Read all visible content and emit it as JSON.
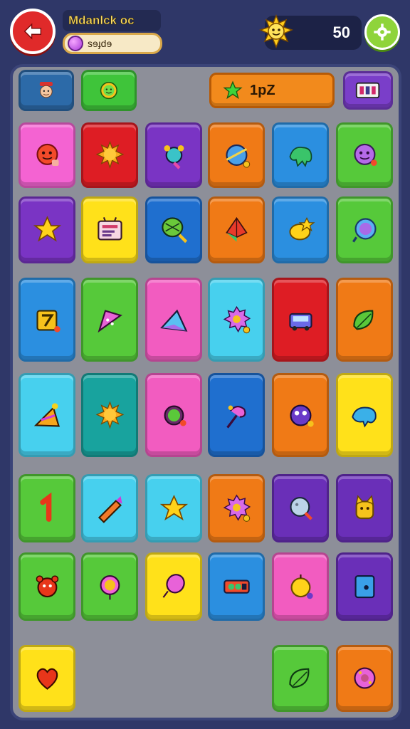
{
  "header": {
    "title": "Mdanlck oc",
    "progress_text": "sɘɟdɘ",
    "score": "50",
    "icons": {
      "back": "back-arrow-icon",
      "score": "sun-icon",
      "settings": "gear-icon",
      "gem": "gem-icon"
    }
  },
  "hud": {
    "level_text": "1pZ",
    "icons": [
      "avatar-icon",
      "smiley-icon",
      "star-icon",
      "menu-icon"
    ]
  },
  "board": {
    "colors": {
      "pink": "#f463d2",
      "red": "#de1d24",
      "purple": "#7a34c4",
      "orange": "#f07a16",
      "blue": "#2b8fe0",
      "green": "#56c93a",
      "yellow": "#ffe11a",
      "cyan": "#47d0ee",
      "teal": "#18a39e",
      "magenta": "#f25cc0",
      "darkblue": "#1f6fcf",
      "violet": "#6a2fb8"
    },
    "rows": [
      [
        "pink:face-icon",
        "red:sun-icon",
        "purple:beetle-icon",
        "orange:planet-icon",
        "blue:dino-icon",
        "green:smiley-icon"
      ],
      [
        "purple:star-icon",
        "yellow:tv-icon",
        "darkblue:racket-icon",
        "orange:kite-icon",
        "blue:lemon-icon",
        "green:bubble-icon"
      ],
      [
        "blue:square-icon",
        "green:cone-icon",
        "magenta:triangle-icon",
        "cyan:gear-icon",
        "red:car-icon",
        "orange:leaf-icon"
      ],
      [
        "cyan:ruler-icon",
        "teal:sun-icon",
        "magenta:ring-icon",
        "darkblue:lollipop-icon",
        "orange:monster-icon",
        "yellow:whale-icon"
      ],
      [
        "green:number-one-icon",
        "cyan:crayon-icon",
        "cyan:star-icon",
        "orange:gear-icon",
        "violet:moon-icon",
        "violet:cat-icon"
      ],
      [
        "green:bear-icon",
        "green:ball-icon",
        "yellow:balloon-icon",
        "blue:battery-icon",
        "magenta:fruit-icon",
        "violet:phone-icon"
      ],
      [
        "yellow:heart-icon",
        "",
        "",
        "",
        "green:leaf-icon",
        "orange:donut-icon"
      ]
    ]
  }
}
